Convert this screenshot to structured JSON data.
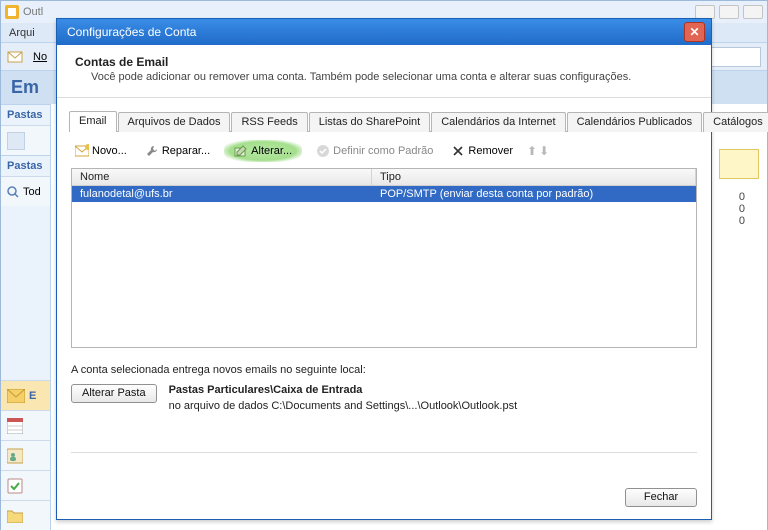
{
  "bg": {
    "title_prefix": "Outl",
    "menu": {
      "arquivo": "Arqui",
      "novo": "No"
    },
    "heading": "Em",
    "nav": {
      "pastas1": "Pastas",
      "pastas2": "Pastas",
      "tod": "Tod",
      "email": "E",
      "section_labels": [
        "",
        "",
        "",
        ""
      ]
    },
    "right_numbers": [
      "0",
      "0",
      "0"
    ]
  },
  "dialog": {
    "title": "Configurações de Conta",
    "header_title": "Contas de Email",
    "header_desc": "Você pode adicionar ou remover uma conta. Também pode selecionar uma conta e alterar suas configurações.",
    "tabs": {
      "email": "Email",
      "arquivos": "Arquivos de Dados",
      "rss": "RSS Feeds",
      "sharepoint": "Listas do SharePoint",
      "calint": "Calendários da Internet",
      "calpub": "Calendários Publicados",
      "catalogos": "Catálogos"
    },
    "toolbar": {
      "novo": "Novo...",
      "reparar": "Reparar...",
      "alterar": "Alterar...",
      "padrao": "Definir como Padrão",
      "remover": "Remover"
    },
    "list": {
      "col_name": "Nome",
      "col_type": "Tipo",
      "rows": [
        {
          "name": "fulanodetal@ufs.br",
          "type": "POP/SMTP (enviar desta conta por padrão)"
        }
      ]
    },
    "delivery": {
      "intro": "A conta selecionada entrega novos emails no seguinte local:",
      "btn": "Alterar Pasta",
      "location": "Pastas Particulares\\Caixa de Entrada",
      "file": "no arquivo de dados C:\\Documents and Settings\\...\\Outlook\\Outlook.pst"
    },
    "close_btn": "Fechar"
  }
}
